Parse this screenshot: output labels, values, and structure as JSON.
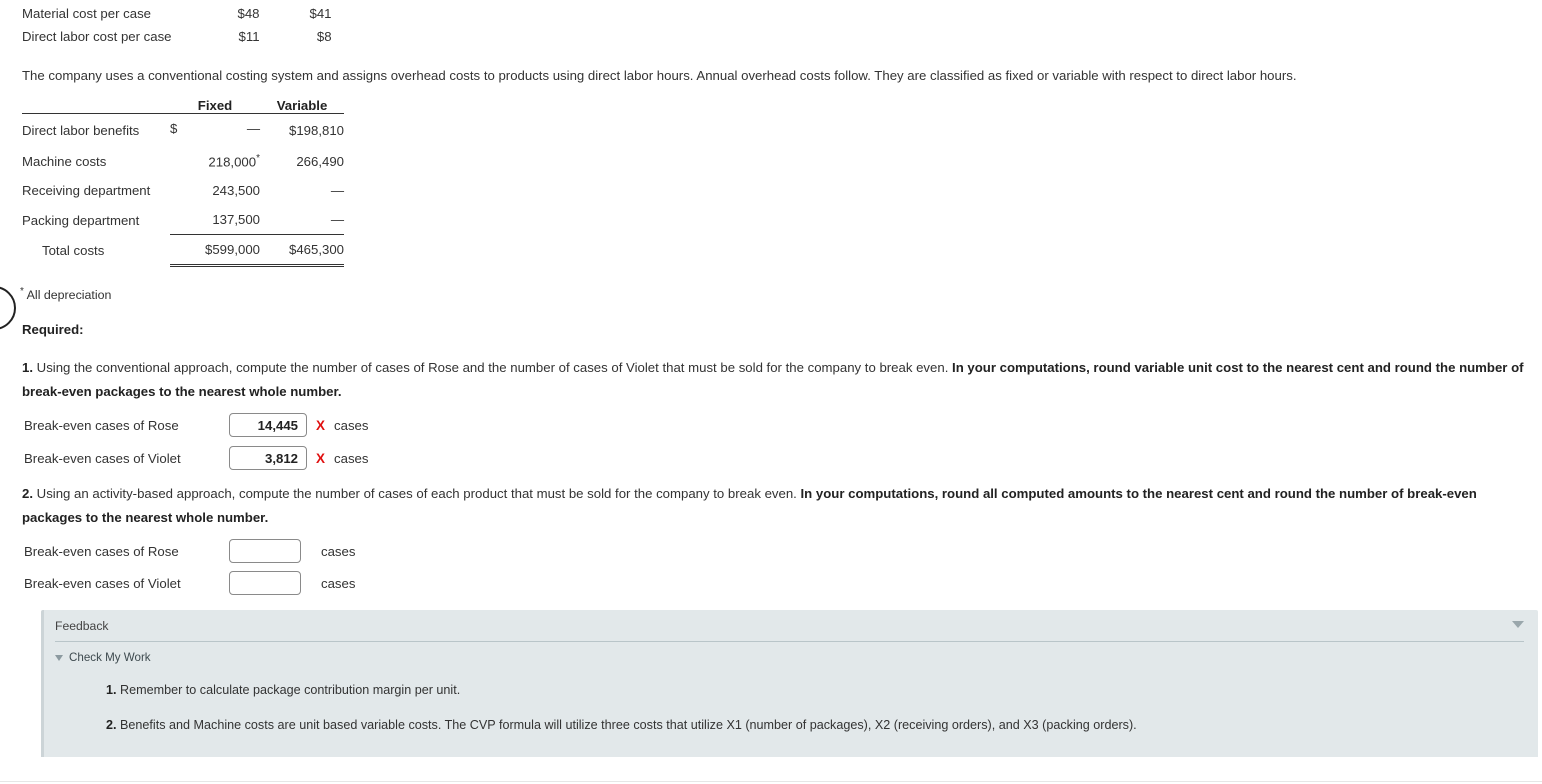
{
  "top_table": {
    "rows": [
      {
        "label": "Material cost per case",
        "col1": "$48",
        "col2": "$41"
      },
      {
        "label": "Direct labor cost per case",
        "col1": "$11",
        "col2": "$8"
      }
    ]
  },
  "intro_paragraph": "The company uses a conventional costing system and assigns overhead costs to products using direct labor hours. Annual overhead costs follow. They are classified as fixed or variable with respect to direct labor hours.",
  "overhead_table": {
    "headers": {
      "blank": "",
      "fixed": "Fixed",
      "variable": "Variable"
    },
    "rows": [
      {
        "label": "Direct labor benefits",
        "fixed_symbol": "$",
        "fixed": "—",
        "variable": "$198,810"
      },
      {
        "label": "Machine costs",
        "fixed_symbol": "",
        "fixed": "218,000",
        "fixed_star": "*",
        "variable": "266,490"
      },
      {
        "label": "Receiving department",
        "fixed_symbol": "",
        "fixed": "243,500",
        "variable": "—"
      },
      {
        "label": "Packing department",
        "fixed_symbol": "",
        "fixed": "137,500",
        "variable": "—"
      }
    ],
    "total": {
      "label": "Total costs",
      "fixed": "$599,000",
      "variable": "$465,300"
    },
    "footnote_marker": "*",
    "footnote": "All depreciation"
  },
  "required": {
    "title": "Required:",
    "q1": {
      "number": "1.",
      "text_plain": " Using the conventional approach, compute the number of cases of Rose and the number of cases of Violet that must be sold for the company to break even. ",
      "text_bold": "In your computations, round variable unit cost to the nearest cent and round the number of break-even packages to the nearest whole number.",
      "answers": [
        {
          "label": "Break-even cases of Rose",
          "value": "14,445",
          "mark": "X",
          "unit": "cases",
          "placeholder": ""
        },
        {
          "label": "Break-even cases of Violet",
          "value": "3,812",
          "mark": "X",
          "unit": "cases",
          "placeholder": ""
        }
      ]
    },
    "q2": {
      "number": "2.",
      "text_plain": " Using an activity-based approach, compute the number of cases of each product that must be sold for the company to break even. ",
      "text_bold": "In your computations, round all computed amounts to the nearest cent and round the number of break-even packages to the nearest whole number.",
      "answers": [
        {
          "label": "Break-even cases of Rose",
          "value": "",
          "mark": "",
          "unit": "cases",
          "placeholder": ""
        },
        {
          "label": "Break-even cases of Violet",
          "value": "",
          "mark": "",
          "unit": "cases",
          "placeholder": ""
        }
      ]
    }
  },
  "feedback": {
    "title": "Feedback",
    "collapse_icon": "caret-down-icon",
    "check_my_work": "Check My Work",
    "items": [
      {
        "number": "1.",
        "text": " Remember to calculate package contribution margin per unit."
      },
      {
        "number": "2.",
        "text": " Benefits and Machine costs are unit based variable costs. The CVP formula will utilize three costs that utilize X1 (number of packages), X2 (receiving orders), and X3 (packing orders)."
      }
    ]
  },
  "colors": {
    "error_mark": "#e01010",
    "feedback_bg": "#e2e8ea",
    "text": "#333333"
  }
}
